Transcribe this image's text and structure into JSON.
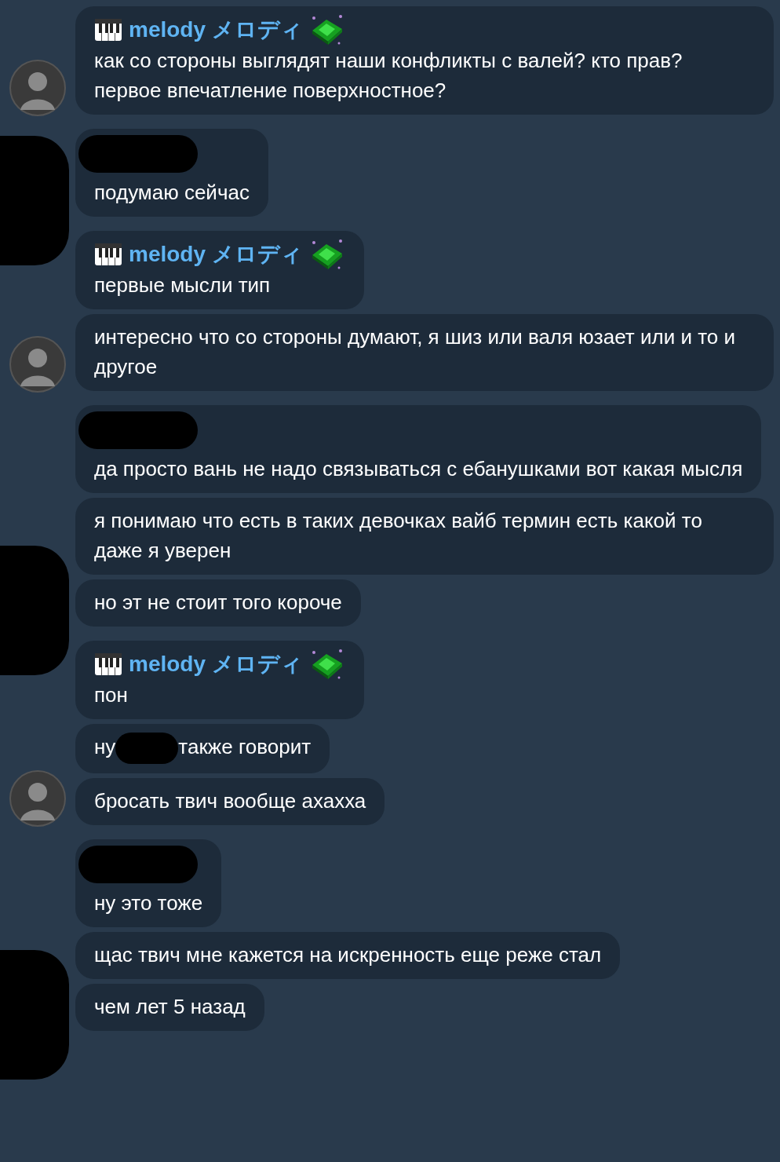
{
  "groups": [
    {
      "kind": "avatar",
      "messages": [
        {
          "sender": "melody メロディ",
          "segments": [
            {
              "kind": "text",
              "text": "как со стороны выглядят наши конфликты с валей? кто прав? первое впечатление поверхностное?"
            }
          ]
        }
      ]
    },
    {
      "kind": "redacted",
      "messages": [
        {
          "sender_redacted": true,
          "segments": [
            {
              "kind": "text",
              "text": "подумаю сейчас"
            }
          ]
        }
      ]
    },
    {
      "kind": "avatar",
      "messages": [
        {
          "sender": "melody メロディ",
          "segments": [
            {
              "kind": "text",
              "text": "первые мысли тип"
            }
          ]
        },
        {
          "segments": [
            {
              "kind": "text",
              "text": "интересно что со стороны думают, я шиз или валя юзает или и то и другое"
            }
          ]
        }
      ]
    },
    {
      "kind": "redacted",
      "messages": [
        {
          "sender_redacted": true,
          "segments": [
            {
              "kind": "text",
              "text": "да просто вань не надо связываться с ебанушками вот какая мысля"
            }
          ]
        },
        {
          "segments": [
            {
              "kind": "text",
              "text": "я понимаю что есть в таких девочках вайб термин есть какой то даже я уверен"
            }
          ]
        },
        {
          "segments": [
            {
              "kind": "text",
              "text": "но эт не стоит того короче"
            }
          ]
        }
      ]
    },
    {
      "kind": "avatar",
      "messages": [
        {
          "sender": "melody メロディ",
          "segments": [
            {
              "kind": "text",
              "text": "пон"
            }
          ]
        },
        {
          "segments": [
            {
              "kind": "text",
              "text": "ну"
            },
            {
              "kind": "redacted"
            },
            {
              "kind": "text",
              "text": "также говорит"
            }
          ]
        },
        {
          "segments": [
            {
              "kind": "text",
              "text": "бросать твич вообще ахахха"
            }
          ]
        }
      ]
    },
    {
      "kind": "redacted",
      "messages": [
        {
          "sender_redacted": true,
          "segments": [
            {
              "kind": "text",
              "text": "ну это тоже"
            }
          ]
        },
        {
          "segments": [
            {
              "kind": "text",
              "text": "щас твич мне кажется на искренность еще реже стал"
            }
          ]
        },
        {
          "segments": [
            {
              "kind": "text",
              "text": "чем лет 5 назад"
            }
          ]
        }
      ]
    }
  ]
}
